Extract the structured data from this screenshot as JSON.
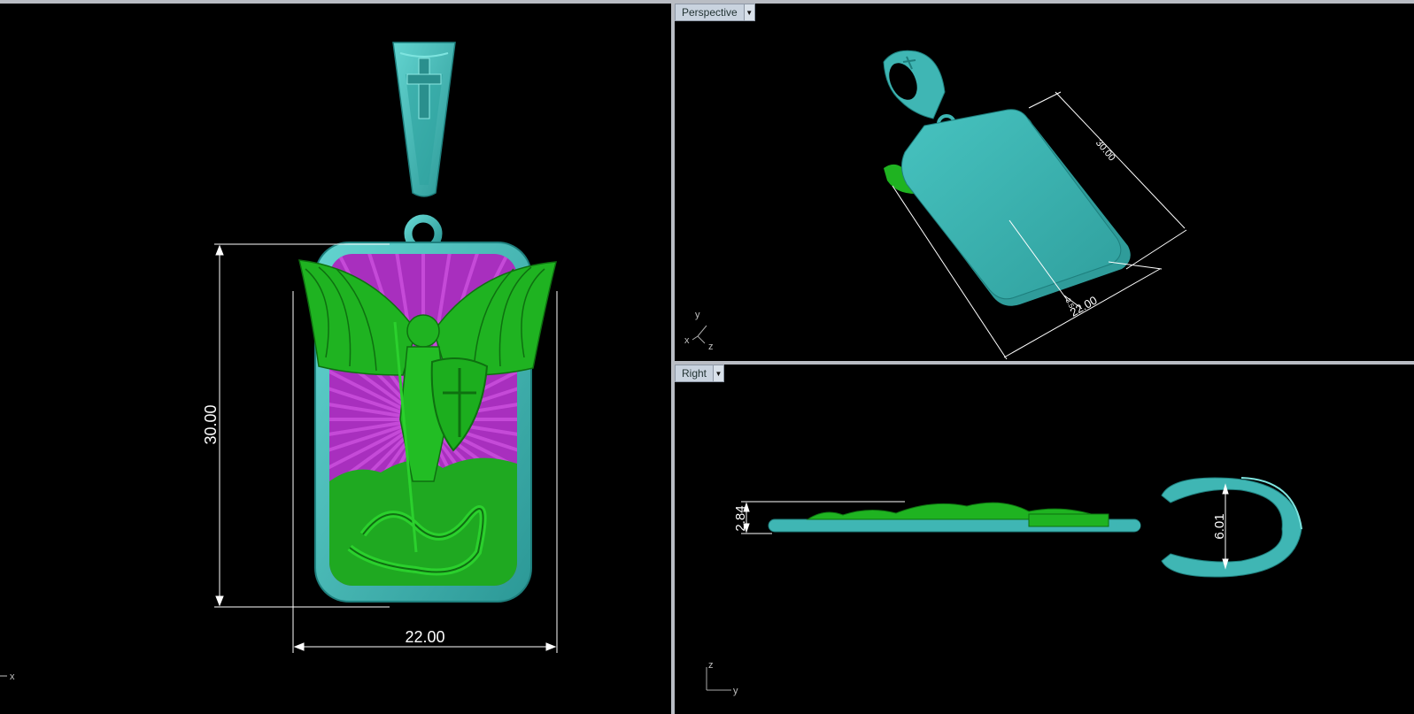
{
  "viewports": {
    "perspective": {
      "label": "Perspective"
    },
    "right": {
      "label": "Right"
    }
  },
  "front_view": {
    "dims": {
      "height": "30.00",
      "width": "22.00"
    },
    "axis": {
      "x": "x"
    }
  },
  "perspective_view": {
    "dims": {
      "length": "30.00",
      "width": "22.00",
      "thickness": "3.5"
    },
    "axis": {
      "y": "y",
      "x": "x",
      "z": "z"
    }
  },
  "right_view": {
    "dims": {
      "thickness": "2.84",
      "bail_opening": "6.01"
    },
    "axis": {
      "z": "z",
      "y": "y"
    }
  },
  "colors": {
    "metal": "#3fb6b4",
    "relief": "#1db81f",
    "background_rays": "#c54ad8",
    "dimension_lines": "#ffffff"
  }
}
